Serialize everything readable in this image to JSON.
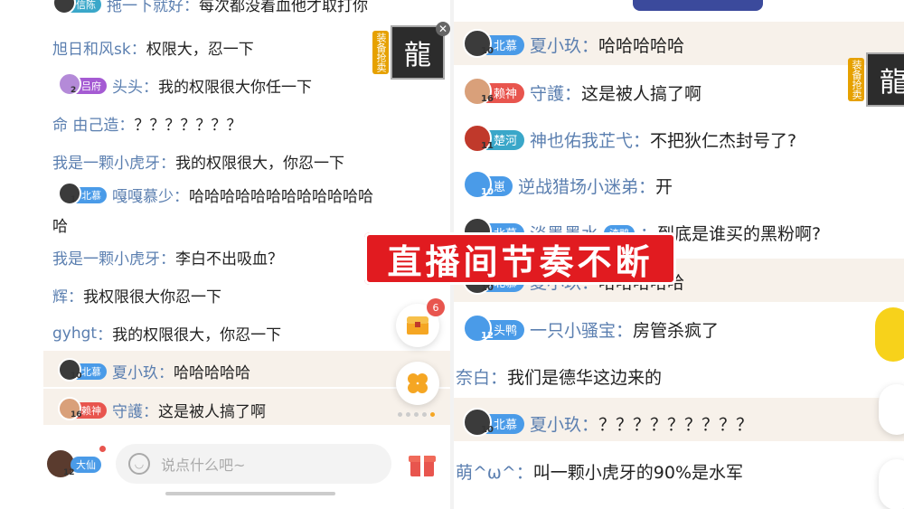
{
  "left": {
    "messages": [
      {
        "name": "拖一下就好",
        "text": "每次都没着血他才取打你",
        "badge": "信陈",
        "level": ""
      },
      {
        "name": "旭日和风sk",
        "text": "权限大，忍一下"
      },
      {
        "name": "头头",
        "text": "我的权限很大你任一下",
        "badge": "吕府",
        "level": "2"
      },
      {
        "name": "命 由己造",
        "text": "？？？？？？？"
      },
      {
        "name": "我是一颗小虎牙",
        "text": "我的权限很大，你忍一下"
      },
      {
        "name": "嘎嘎慕少",
        "text": "哈哈哈哈哈哈哈哈哈哈哈哈",
        "text2": "哈",
        "badge": "北慕",
        "level": "1"
      },
      {
        "name": "我是一颗小虎牙",
        "text": "李白不出吸血？"
      },
      {
        "name": "辉",
        "text": "我权限很大你忍一下"
      },
      {
        "name": "gyhgt",
        "text": "我的权限很大，你忍一下"
      },
      {
        "name": "夏小玖",
        "text": "哈哈哈哈哈",
        "badge": "北慕",
        "level": "10"
      },
      {
        "name": "守護",
        "text": "这是被人搞了啊",
        "badge": "赖神",
        "level": "16"
      }
    ],
    "input_placeholder": "说点什么吧~",
    "user_badge": "大仙",
    "user_level": "12",
    "treasure_count": "6",
    "ad_tag": "装备抢卖",
    "ad_char": "龍"
  },
  "right": {
    "messages": [
      {
        "name": "夏小玖",
        "text": "哈哈哈哈哈",
        "badge": "北慕",
        "level": "10"
      },
      {
        "name": "守護",
        "text": "这是被人搞了啊",
        "badge": "赖神",
        "level": "16"
      },
      {
        "name": "神也佑我芷弋",
        "text": "不把狄仁杰封号了?",
        "badge": "楚河",
        "level": "11"
      },
      {
        "name": "逆战猎场小迷弟",
        "text": "开",
        "badge": "崽",
        "level": "10"
      },
      {
        "name": "淡墨墨水",
        "text": "到底是谁买的黑粉啊?",
        "badge": "北慕",
        "level": "",
        "extra_badge": "渣鸭"
      },
      {
        "name": "夏小玖",
        "text": "哈哈哈哈哈",
        "badge": "北慕",
        "level": "10"
      },
      {
        "name": "一只小骚宝",
        "text": "房管杀疯了",
        "badge": "头鸭",
        "level": "12"
      },
      {
        "name": "奈白",
        "text": "我们是德华这边来的"
      },
      {
        "name": "夏小玖",
        "text": "？？？？？？？？？",
        "badge": "北慕",
        "level": "10"
      },
      {
        "name": "萌^ω^",
        "text": "叫一颗小虎牙的90%是水军"
      }
    ],
    "ad_tag": "装备抢卖",
    "ad_char": "龍"
  },
  "overlay_title": "直播间节奏不断",
  "colors": {
    "name": "#5b7fb0",
    "highlight_bg": "#f7f1ea",
    "overlay_red": "#e11b20",
    "badge_blue": "#4a9be8",
    "badge_red": "#e8554e"
  }
}
